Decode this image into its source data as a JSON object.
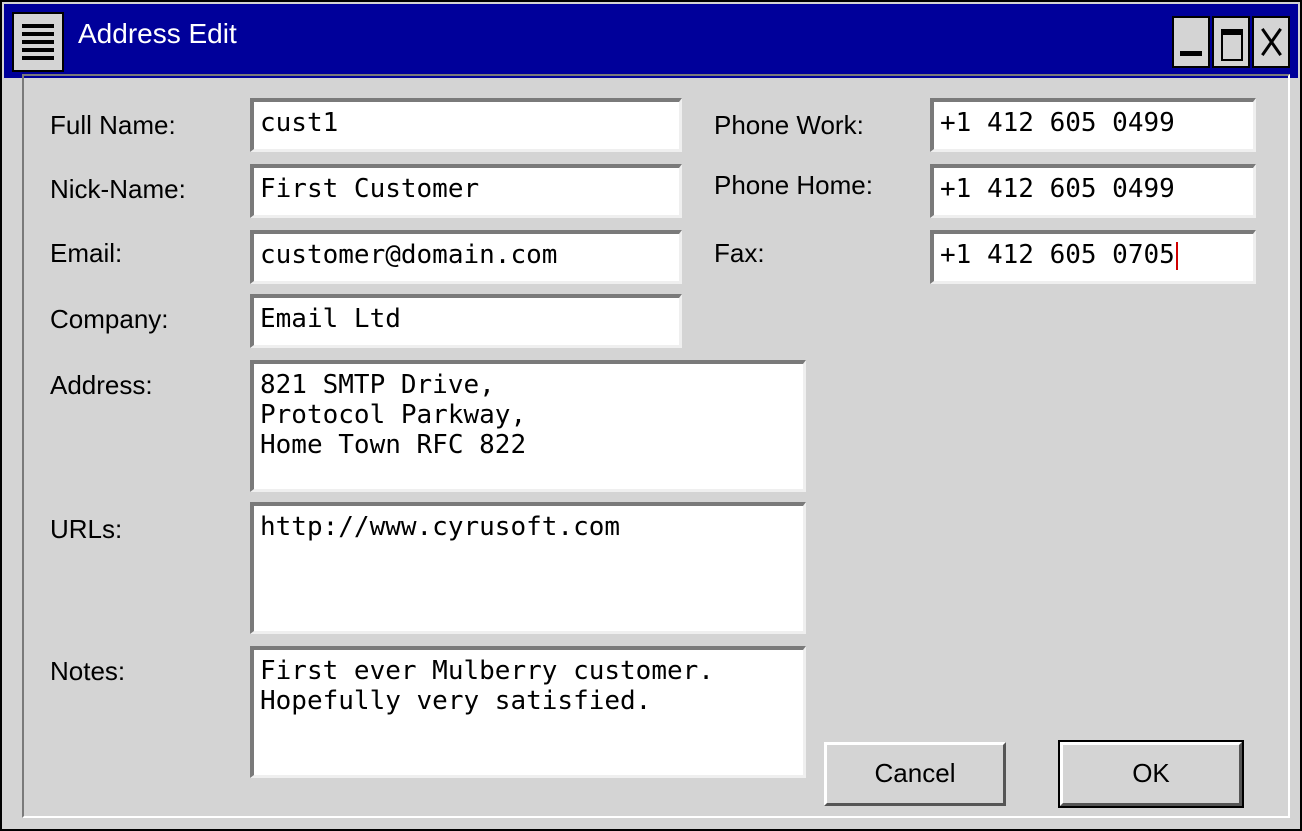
{
  "window": {
    "title": "Address Edit",
    "icons": [
      "menu-icon",
      "minimize-icon",
      "maximize-icon",
      "close-icon"
    ]
  },
  "form": {
    "full_name": {
      "label": "Full Name:",
      "value": "cust1"
    },
    "nick_name": {
      "label": "Nick-Name:",
      "value": "First Customer"
    },
    "email": {
      "label": "Email:",
      "value": "customer@domain.com"
    },
    "company": {
      "label": "Company:",
      "value": "Email Ltd"
    },
    "address": {
      "label": "Address:",
      "value": "821 SMTP Drive,\nProtocol Parkway,\nHome Town RFC 822"
    },
    "urls": {
      "label": "URLs:",
      "value": "http://www.cyrusoft.com"
    },
    "notes": {
      "label": "Notes:",
      "value": "First ever Mulberry customer.\nHopefully very satisfied."
    },
    "phone_work": {
      "label": "Phone Work:",
      "value": "+1 412 605 0499"
    },
    "phone_home": {
      "label": "Phone Home:",
      "value": "+1 412 605 0499"
    },
    "fax": {
      "label": "Fax:",
      "value": "+1 412 605 0705"
    }
  },
  "buttons": {
    "cancel": "Cancel",
    "ok": "OK"
  },
  "colors": {
    "titlebar": "#00009a",
    "background": "#d4d4d4",
    "caret": "#d00000"
  }
}
